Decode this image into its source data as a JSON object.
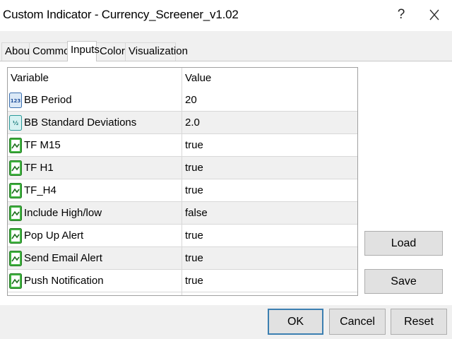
{
  "window": {
    "title": "Custom Indicator - Currency_Screener_v1.02",
    "help_glyph": "?"
  },
  "tabs": [
    {
      "label": "About"
    },
    {
      "label": "Common"
    },
    {
      "label": "Inputs"
    },
    {
      "label": "Colors"
    },
    {
      "label": "Visualization"
    }
  ],
  "grid": {
    "headers": {
      "variable": "Variable",
      "value": "Value"
    },
    "rows": [
      {
        "variable": "BB Period",
        "value": "20",
        "icon": "integer-icon"
      },
      {
        "variable": "BB Standard Deviations",
        "value": "2.0",
        "icon": "double-icon"
      },
      {
        "variable": "TF M15",
        "value": "true",
        "icon": "bool-icon"
      },
      {
        "variable": "TF H1",
        "value": "true",
        "icon": "bool-icon"
      },
      {
        "variable": "TF_H4",
        "value": "true",
        "icon": "bool-icon"
      },
      {
        "variable": "Include High/low",
        "value": "false",
        "icon": "bool-icon"
      },
      {
        "variable": "Pop Up Alert",
        "value": "true",
        "icon": "bool-icon"
      },
      {
        "variable": "Send Email Alert",
        "value": "true",
        "icon": "bool-icon"
      },
      {
        "variable": "Push Notification",
        "value": "true",
        "icon": "bool-icon"
      }
    ]
  },
  "side_buttons": {
    "load": "Load",
    "save": "Save"
  },
  "footer_buttons": {
    "ok": "OK",
    "cancel": "Cancel",
    "reset": "Reset"
  },
  "colors": {
    "accent": "#3c7fb1",
    "alt_row": "#f0f0f0",
    "icon_green": "#2f9a2f"
  }
}
